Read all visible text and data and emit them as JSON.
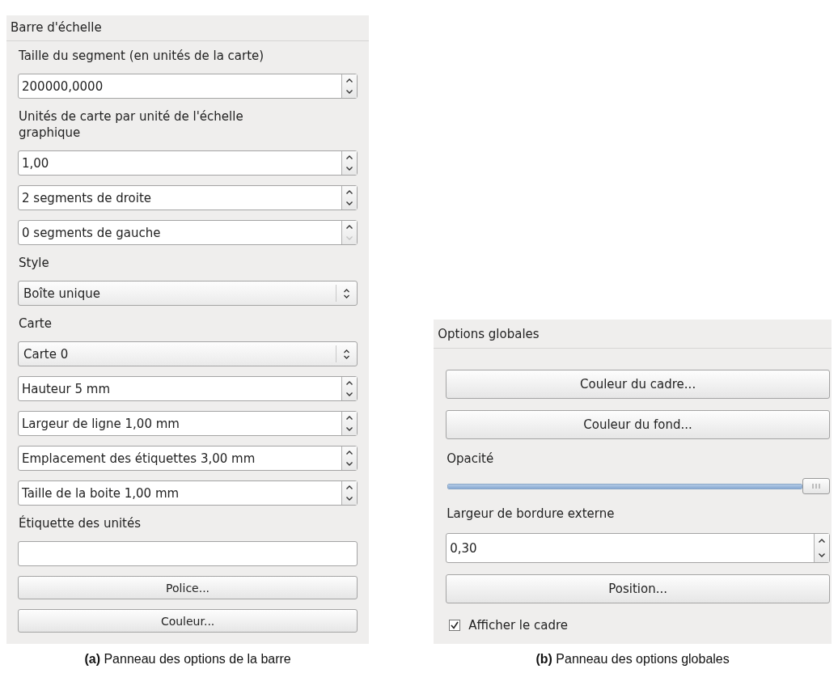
{
  "panels": [
    {
      "title": "Barre d'échelle",
      "items": [
        {
          "kind": "label",
          "text": "Taille du segment (en unités de la carte)"
        },
        {
          "kind": "spin",
          "value": "200000,0000",
          "down_disabled": false
        },
        {
          "kind": "label",
          "text": "Unités de carte par unité de l'échelle graphique"
        },
        {
          "kind": "spin",
          "value": "1,00",
          "down_disabled": false
        },
        {
          "kind": "spin",
          "value": "2 segments de droite",
          "down_disabled": false
        },
        {
          "kind": "spin",
          "value": "0 segments de gauche",
          "down_disabled": true
        },
        {
          "kind": "label",
          "text": "Style"
        },
        {
          "kind": "combo",
          "value": "Boîte unique"
        },
        {
          "kind": "label",
          "text": "Carte"
        },
        {
          "kind": "combo",
          "value": "Carte 0"
        },
        {
          "kind": "spin",
          "value": "Hauteur 5 mm",
          "down_disabled": false
        },
        {
          "kind": "spin",
          "value": "Largeur de ligne 1,00 mm",
          "down_disabled": false
        },
        {
          "kind": "spin",
          "value": "Emplacement des étiquettes 3,00 mm",
          "down_disabled": false
        },
        {
          "kind": "spin",
          "value": "Taille de la boite 1,00 mm",
          "down_disabled": false
        },
        {
          "kind": "label",
          "text": "Étiquette des unités"
        },
        {
          "kind": "input"
        },
        {
          "kind": "button",
          "text": "Police..."
        },
        {
          "kind": "button",
          "text": "Couleur..."
        }
      ],
      "caption": "**(a)** Panneau des options de la barre"
    },
    {
      "title": "Options globales",
      "items": [
        {
          "kind": "button",
          "text": "Couleur du cadre..."
        },
        {
          "kind": "button",
          "text": "Couleur du fond..."
        },
        {
          "kind": "label",
          "text": "Opacité"
        },
        {
          "kind": "slider",
          "level": 1
        },
        {
          "kind": "label",
          "text": "Largeur de bordure externe"
        },
        {
          "kind": "spin",
          "value": "0,30",
          "down_disabled": false
        },
        {
          "kind": "button",
          "text": "Position..."
        },
        {
          "kind": "checkbox",
          "text": "Afficher le cadre",
          "checked": true
        }
      ],
      "caption": "**(b)** Panneau des options globales"
    }
  ]
}
